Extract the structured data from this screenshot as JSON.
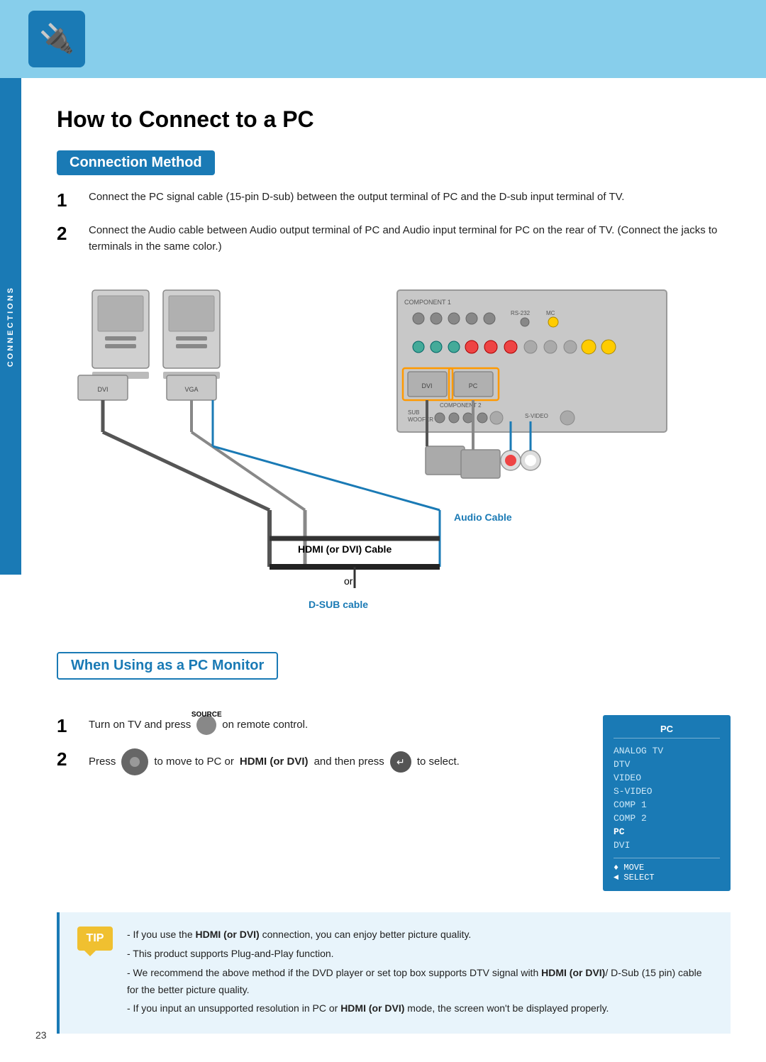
{
  "header": {
    "logo_icon": "🔌",
    "top_banner_color": "#87CEEB"
  },
  "page": {
    "title": "How to Connect to a PC",
    "number": "23",
    "sidebar_label": "CONNECTIONS"
  },
  "connection_method": {
    "section_title": "Connection Method",
    "step1": "Connect the PC signal cable (15-pin D-sub) between the output terminal of PC and the D-sub input terminal of TV.",
    "step2": "Connect the Audio cable between Audio output terminal of PC and Audio input terminal for PC on the rear of TV. (Connect the jacks to terminals in the same color.)",
    "cable_labels": {
      "audio": "Audio Cable",
      "hdmi": "HDMI (or DVI) Cable",
      "or": "or",
      "dsub": "D-SUB cable"
    }
  },
  "pc_monitor": {
    "section_title": "When Using as a PC Monitor",
    "step1_prefix": "Turn on TV and press",
    "step1_suffix": "on remote control.",
    "step1_source_label": "SOURCE",
    "step2_prefix": "Press",
    "step2_middle": "to move to PC or",
    "step2_bold": "HDMI (or DVI)",
    "step2_suffix": "and then press",
    "step2_end": "to select.",
    "menu": {
      "title": "PC",
      "items": [
        {
          "label": "ANALOG TV",
          "active": false
        },
        {
          "label": "DTV",
          "active": false
        },
        {
          "label": "VIDEO",
          "active": false
        },
        {
          "label": "S-VIDEO",
          "active": false
        },
        {
          "label": "COMP 1",
          "active": false
        },
        {
          "label": "COMP 2",
          "active": false
        },
        {
          "label": "PC",
          "active": true
        },
        {
          "label": "DVI",
          "active": false
        }
      ],
      "move_label": "♦ MOVE",
      "select_label": "◄ SELECT"
    }
  },
  "tip": {
    "badge": "TIP",
    "lines": [
      "- If you use the HDMI (or DVI) connection, you can enjoy better picture quality.",
      "- This product supports Plug-and-Play function.",
      "- We recommend the above method if the DVD player or set top box supports DTV signal with HDMI (or DVI)/ D-Sub (15 pin) cable for the better picture quality.",
      "- If you input an unsupported resolution in PC or HDMI (or DVI) mode, the screen won't be displayed properly."
    ]
  }
}
